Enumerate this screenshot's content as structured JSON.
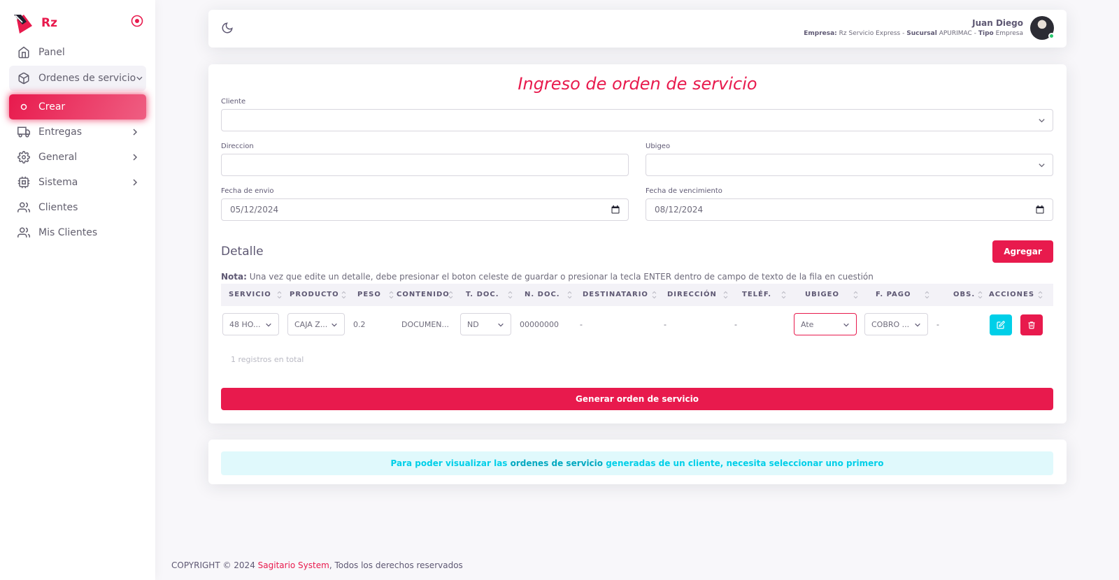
{
  "brand": {
    "name": "Rz",
    "accent": "#e81a4d"
  },
  "sidebar": {
    "items": [
      {
        "label": "Panel",
        "icon": "home-icon"
      },
      {
        "label": "Ordenes de servicio",
        "icon": "package-icon"
      },
      {
        "label": "Crear",
        "icon": "circle-icon"
      },
      {
        "label": "Entregas",
        "icon": "truck-icon"
      },
      {
        "label": "General",
        "icon": "settings-icon"
      },
      {
        "label": "Sistema",
        "icon": "cpu-icon"
      },
      {
        "label": "Clientes",
        "icon": "users-icon"
      },
      {
        "label": "Mis Clientes",
        "icon": "users-icon"
      }
    ]
  },
  "navbar": {
    "user_name": "Juan Diego",
    "empresa_label": "Empresa:",
    "empresa_value": "Rz Servicio Express",
    "sep": "-",
    "sucursal_label": "Sucursal",
    "sucursal_value": "APURIMAC",
    "tipo_label": "Tipo",
    "tipo_value": "Empresa"
  },
  "form": {
    "title": "Ingreso de orden de servicio",
    "cliente_label": "Cliente",
    "cliente_value": "",
    "direccion_label": "Direccion",
    "direccion_value": "",
    "ubigeo_label": "Ubigeo",
    "ubigeo_value": "",
    "fecha_envio_label": "Fecha de envio",
    "fecha_envio_value": "05/12/2024",
    "fecha_venc_label": "Fecha de vencimiento",
    "fecha_venc_value": "08/12/2024"
  },
  "detalle": {
    "title": "Detalle",
    "add_button": "Agregar",
    "note_label": "Nota:",
    "note_text": "Una vez que edite un detalle, debe presionar el boton celeste de guardar o presionar la tecla ENTER dentro de campo de texto de la fila en cuestión",
    "columns": [
      "SERVICIO",
      "PRODUCTO",
      "PESO",
      "CONTENIDO",
      "T. DOC.",
      "N. DOC.",
      "DESTINATARIO",
      "DIRECCIÓN",
      "TELÉF.",
      "UBIGEO",
      "F. PAGO",
      "OBS.",
      "ACCIONES"
    ],
    "row": {
      "servicio": "48 HO...",
      "producto": "CAJA Z...",
      "peso": "0.2",
      "contenido": "DOCUMEN...",
      "tdoc": "ND",
      "ndoc": "00000000",
      "destinatario": "-",
      "direccion": "-",
      "telefono": "-",
      "ubigeo": "Ate",
      "fpago": "COBRO ...",
      "obs": "-"
    },
    "total": "1 registros en total",
    "generate_button": "Generar orden de servicio"
  },
  "info_alert": {
    "part1": "Para poder visualizar las",
    "strong": "ordenes de servicio",
    "part2": "generadas de un cliente, necesita seleccionar uno primero"
  },
  "footer": {
    "prefix": "COPYRIGHT © 2024",
    "brand": "Sagitario System",
    "suffix": ", Todos los derechos reservados"
  }
}
